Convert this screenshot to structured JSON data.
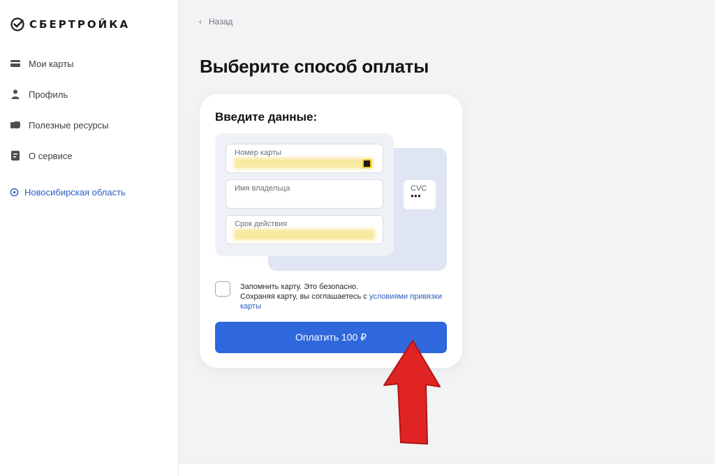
{
  "brand": {
    "name": "СБЕРТРОЙКА",
    "accent": "#2f67dc"
  },
  "sidebar": {
    "items": [
      {
        "label": "Мои карты",
        "icon": "cards-icon"
      },
      {
        "label": "Профиль",
        "icon": "user-icon"
      },
      {
        "label": "Полезные ресурсы",
        "icon": "resources-icon"
      },
      {
        "label": "О сервисе",
        "icon": "document-icon"
      }
    ],
    "region": {
      "label": "Новосибирская область",
      "icon": "location-pin-icon"
    }
  },
  "header": {
    "back_label": "Назад"
  },
  "main": {
    "title": "Выберите способ оплаты",
    "form": {
      "title": "Введите данные:",
      "card_number": {
        "label": "Номер карты"
      },
      "holder": {
        "label": "Имя владельца"
      },
      "expiry": {
        "label": "Срок действия"
      },
      "cvc": {
        "label": "CVC",
        "value": "•••"
      },
      "remember": {
        "line1": "Запомнить карту. Это безопасно.",
        "line2_prefix": "Сохраняя карту, вы соглашаетесь с ",
        "link_text": "условиями привязки карты"
      },
      "pay_button": "Оплатить 100 ₽"
    }
  }
}
